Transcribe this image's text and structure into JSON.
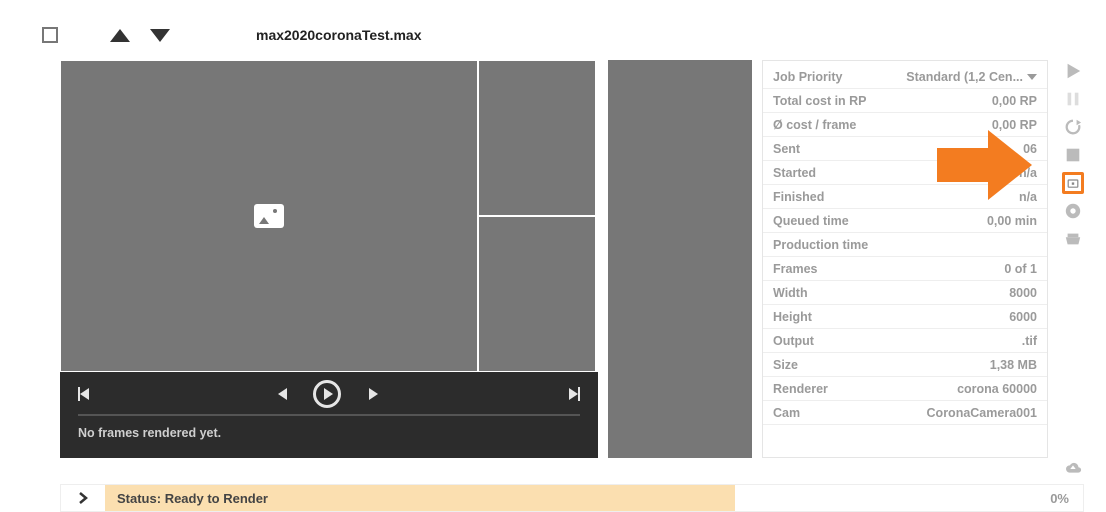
{
  "header": {
    "filename": "max2020coronaTest.max"
  },
  "player": {
    "status": "No frames rendered yet."
  },
  "info": {
    "rows": [
      {
        "label": "Job Priority",
        "value": "Standard (1,2 Cen...",
        "dropdown": true
      },
      {
        "label": "Total cost in RP",
        "value": "0,00 RP"
      },
      {
        "label": "Ø cost / frame",
        "value": "0,00 RP"
      },
      {
        "label": "Sent",
        "value": "06"
      },
      {
        "label": "Started",
        "value": "n/a"
      },
      {
        "label": "Finished",
        "value": "n/a"
      },
      {
        "label": "Queued time",
        "value": "0,00 min"
      },
      {
        "label": "Production time",
        "value": ""
      },
      {
        "label": "Frames",
        "value": "0 of 1"
      },
      {
        "label": "Width",
        "value": "8000"
      },
      {
        "label": "Height",
        "value": "6000"
      },
      {
        "label": "Output",
        "value": ".tif"
      },
      {
        "label": "Size",
        "value": "1,38 MB"
      },
      {
        "label": "Renderer",
        "value": "corona 60000"
      },
      {
        "label": "Cam",
        "value": "CoronaCamera001"
      }
    ]
  },
  "footer": {
    "status_label": "Status:",
    "status_value": "Ready to Render",
    "percent": "0%"
  },
  "icons": {
    "play": "play-icon",
    "pause": "pause-icon",
    "refresh": "refresh-icon",
    "stop": "stop-icon",
    "open": "open-folder-icon",
    "disc": "disc-icon",
    "cloud": "cloud-upload-icon",
    "chat": "chat-icon"
  }
}
